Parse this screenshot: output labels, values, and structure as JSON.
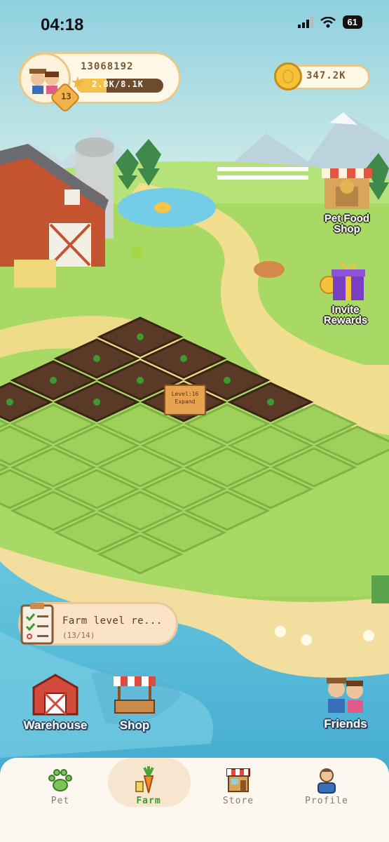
{
  "status_bar": {
    "time": "04:18",
    "battery": "61"
  },
  "player": {
    "id": "13068192",
    "level": "13",
    "xp_text": "2.8K/8.1K",
    "xp_progress": 0.35
  },
  "currency": {
    "coins": "347.2K"
  },
  "side_buttons": {
    "pet_food_shop": "Pet Food Shop",
    "invite_rewards": "Invite Rewards"
  },
  "farm_sign": {
    "level": "Level:16",
    "action": "Expand"
  },
  "task": {
    "title": "Farm level re...",
    "progress": "(13/14)"
  },
  "bottom_buttons": {
    "warehouse": "Warehouse",
    "shop": "Shop",
    "friends": "Friends"
  },
  "tabs": [
    {
      "label": "Pet",
      "icon": "paw-icon",
      "active": false
    },
    {
      "label": "Farm",
      "icon": "carrot-icon",
      "active": true
    },
    {
      "label": "Store",
      "icon": "store-icon",
      "active": false
    },
    {
      "label": "Profile",
      "icon": "profile-icon",
      "active": false
    }
  ],
  "colors": {
    "accent": "#3e9a2f",
    "grass": "#9fd35a",
    "water": "#4fb8d6"
  }
}
